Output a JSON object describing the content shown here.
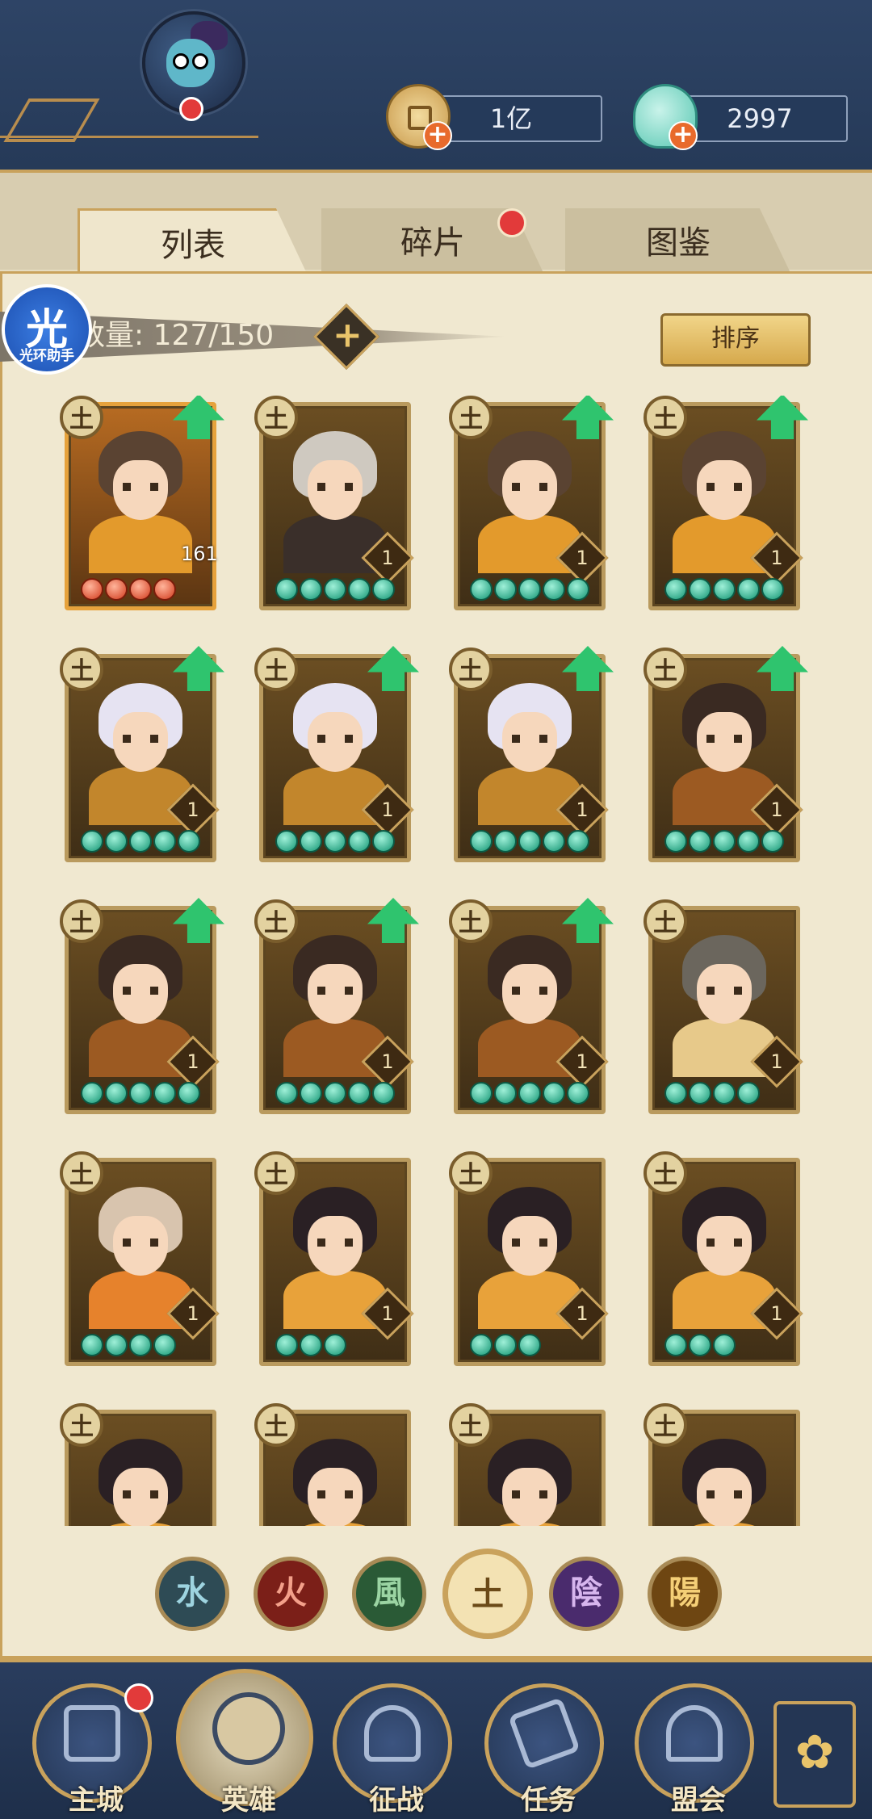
{
  "resources": {
    "coins": "1亿",
    "jade": "2997",
    "add_symbol": "+"
  },
  "tabs": [
    {
      "label": "列表",
      "active": true
    },
    {
      "label": "碎片",
      "active": false,
      "has_notification": true
    },
    {
      "label": "图鉴",
      "active": false
    }
  ],
  "hero_count": {
    "text": "雄数量: 127/150",
    "add_symbol": "+"
  },
  "assistant": {
    "glyph": "光",
    "label": "光环助手"
  },
  "sort_button": "排序",
  "element_badge": "土",
  "heroes": [
    {
      "portrait": "brown-hair-warrior",
      "level": "161",
      "stars": 4,
      "star_color": "red",
      "upgradable": true,
      "frame": "gold"
    },
    {
      "portrait": "silver-hair-sorceress",
      "level": "1",
      "stars": 5,
      "star_color": "green",
      "upgradable": false,
      "frame": "bronze"
    },
    {
      "portrait": "brown-hair-warrior",
      "level": "1",
      "stars": 5,
      "star_color": "green",
      "upgradable": true,
      "frame": "bronze"
    },
    {
      "portrait": "brown-hair-warrior",
      "level": "1",
      "stars": 5,
      "star_color": "green",
      "upgradable": true,
      "frame": "bronze"
    },
    {
      "portrait": "white-hair-general",
      "level": "1",
      "stars": 5,
      "star_color": "green",
      "upgradable": true,
      "frame": "bronze"
    },
    {
      "portrait": "white-hair-general",
      "level": "1",
      "stars": 5,
      "star_color": "green",
      "upgradable": true,
      "frame": "bronze"
    },
    {
      "portrait": "white-hair-general",
      "level": "1",
      "stars": 5,
      "star_color": "green",
      "upgradable": true,
      "frame": "bronze"
    },
    {
      "portrait": "crowned-bearded-lord",
      "level": "1",
      "stars": 5,
      "star_color": "green",
      "upgradable": true,
      "frame": "bronze"
    },
    {
      "portrait": "crowned-bearded-lord",
      "level": "1",
      "stars": 5,
      "star_color": "green",
      "upgradable": true,
      "frame": "bronze"
    },
    {
      "portrait": "crowned-bearded-lord",
      "level": "1",
      "stars": 5,
      "star_color": "green",
      "upgradable": true,
      "frame": "bronze"
    },
    {
      "portrait": "crowned-bearded-lord",
      "level": "1",
      "stars": 5,
      "star_color": "green",
      "upgradable": true,
      "frame": "bronze"
    },
    {
      "portrait": "grey-hair-strategist",
      "level": "1",
      "stars": 4,
      "star_color": "green",
      "upgradable": false,
      "frame": "bronze"
    },
    {
      "portrait": "blonde-archer",
      "level": "1",
      "stars": 4,
      "star_color": "green",
      "upgradable": false,
      "frame": "bronze"
    },
    {
      "portrait": "black-hair-maiden",
      "level": "1",
      "stars": 3,
      "star_color": "green",
      "upgradable": false,
      "frame": "bronze"
    },
    {
      "portrait": "black-hair-maiden",
      "level": "1",
      "stars": 3,
      "star_color": "green",
      "upgradable": false,
      "frame": "bronze"
    },
    {
      "portrait": "black-hair-maiden",
      "level": "1",
      "stars": 3,
      "star_color": "green",
      "upgradable": false,
      "frame": "bronze"
    },
    {
      "portrait": "black-hair-maiden",
      "level": "",
      "stars": 0,
      "star_color": "green",
      "upgradable": false,
      "frame": "bronze"
    },
    {
      "portrait": "black-hair-maiden",
      "level": "",
      "stars": 0,
      "star_color": "green",
      "upgradable": false,
      "frame": "bronze"
    },
    {
      "portrait": "black-hair-maiden",
      "level": "",
      "stars": 0,
      "star_color": "green",
      "upgradable": false,
      "frame": "bronze"
    },
    {
      "portrait": "black-hair-maiden",
      "level": "",
      "stars": 0,
      "star_color": "green",
      "upgradable": false,
      "frame": "bronze"
    }
  ],
  "element_filters": [
    {
      "id": "water",
      "glyph": "水"
    },
    {
      "id": "fire",
      "glyph": "火"
    },
    {
      "id": "wind",
      "glyph": "風"
    },
    {
      "id": "earth",
      "glyph": "土",
      "selected": true
    },
    {
      "id": "yin",
      "glyph": "陰"
    },
    {
      "id": "yang",
      "glyph": "陽"
    }
  ],
  "bottom_nav": [
    {
      "label": "主城",
      "has_notification": true
    },
    {
      "label": "英雄",
      "active": true
    },
    {
      "label": "征战"
    },
    {
      "label": "任务"
    },
    {
      "label": "盟会"
    }
  ],
  "more_icon": "✿",
  "colors": {
    "accent_gold": "#c9a25c",
    "navy": "#2d3e5c",
    "upgrade_green": "#2fc46e",
    "notification_red": "#e23a3a"
  }
}
